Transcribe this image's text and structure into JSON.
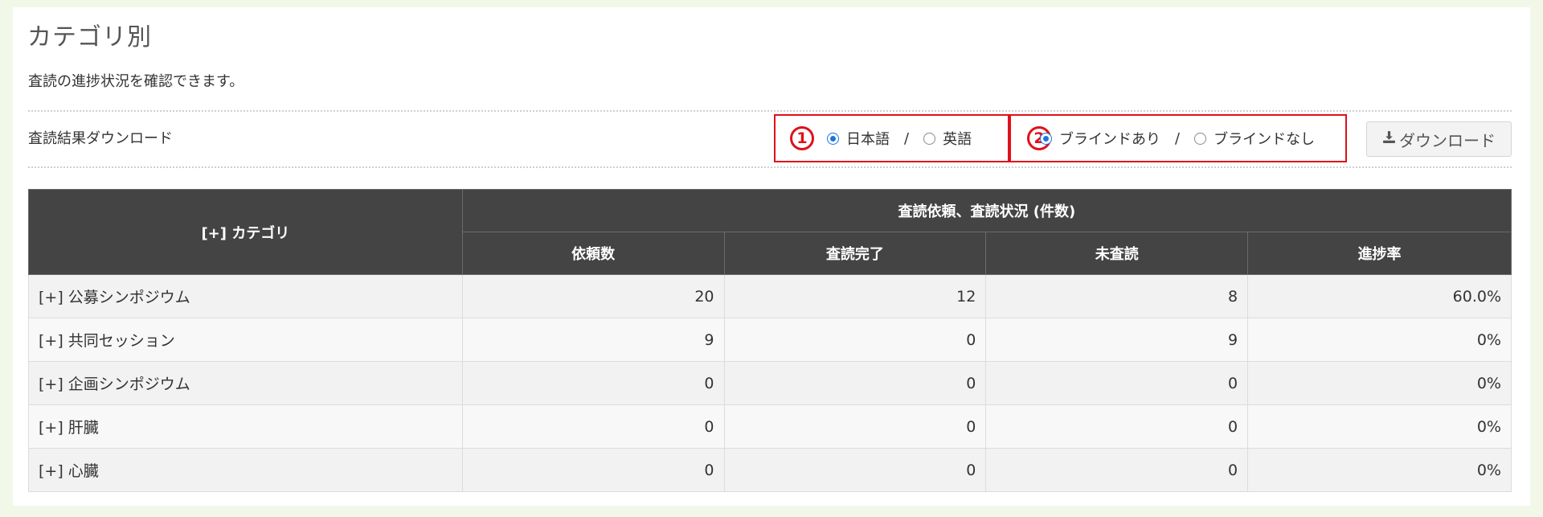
{
  "page": {
    "title": "カテゴリ別",
    "description": "査読の進捗状況を確認できます。"
  },
  "download_section": {
    "label": "査読結果ダウンロード",
    "language_group": {
      "badge": "1",
      "options": [
        {
          "label": "日本語",
          "checked": true
        },
        {
          "label": "英語",
          "checked": false
        }
      ],
      "separator": "/"
    },
    "blind_group": {
      "badge": "2",
      "options": [
        {
          "label": "ブラインドあり",
          "checked": true
        },
        {
          "label": "ブラインドなし",
          "checked": false
        }
      ],
      "separator": "/"
    },
    "button_label": "ダウンロード",
    "button_icon": "download-icon"
  },
  "table": {
    "category_header": "[+] カテゴリ",
    "group_header": "査読依頼、査読状況 (件数)",
    "columns": [
      "依頼数",
      "査読完了",
      "未査読",
      "進捗率"
    ],
    "rows": [
      {
        "category": "[+] 公募シンポジウム",
        "requested": "20",
        "completed": "12",
        "pending": "8",
        "progress": "60.0%"
      },
      {
        "category": "[+] 共同セッション",
        "requested": "9",
        "completed": "0",
        "pending": "9",
        "progress": "0%"
      },
      {
        "category": "[+] 企画シンポジウム",
        "requested": "0",
        "completed": "0",
        "pending": "0",
        "progress": "0%"
      },
      {
        "category": "[+] 肝臓",
        "requested": "0",
        "completed": "0",
        "pending": "0",
        "progress": "0%"
      },
      {
        "category": "[+] 心臓",
        "requested": "0",
        "completed": "0",
        "pending": "0",
        "progress": "0%"
      }
    ]
  },
  "colors": {
    "annotation_red": "#e0101a",
    "radio_blue": "#1b75e0",
    "header_dark": "#444444",
    "page_background": "#f2f8e8"
  }
}
